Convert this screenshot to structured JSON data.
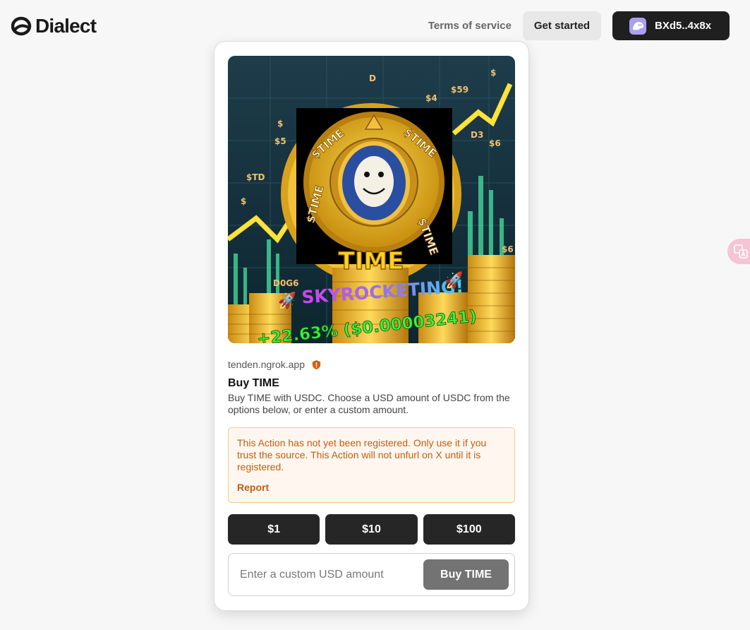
{
  "header": {
    "logo_text": "Dialect",
    "terms_label": "Terms of service",
    "get_started_label": "Get started",
    "wallet_label": "BXd5..4x8x"
  },
  "translate_bubble": {
    "icon": "translate-icon"
  },
  "action": {
    "image": {
      "headline": "TIME",
      "tagline": "SKYROCKETING!",
      "change": "+22.63% ($0.00003241)",
      "coin_ring_text": "$TIME",
      "ticker_labels": [
        "$",
        "$",
        "$",
        "$",
        "$",
        "$6",
        "D",
        "$",
        "$6",
        "$",
        "$59",
        "D0G6"
      ]
    },
    "source": "tenden.ngrok.app",
    "title": "Buy TIME",
    "description": "Buy TIME with USDC. Choose a USD amount of USDC from the options below, or enter a custom amount.",
    "warning": {
      "text": "This Action has not yet been registered. Only use it if you trust the source. This Action will not unfurl on X until it is registered.",
      "report_label": "Report"
    },
    "amount_buttons": [
      {
        "label": "$1"
      },
      {
        "label": "$10"
      },
      {
        "label": "$100"
      }
    ],
    "custom_amount": {
      "placeholder": "Enter a custom USD amount",
      "value": "",
      "submit_label": "Buy TIME"
    }
  },
  "colors": {
    "accent_dark": "#262626",
    "warning_text": "#c25d12",
    "warning_border": "#f5c98c",
    "wallet_brand": "#ab9ff2"
  }
}
